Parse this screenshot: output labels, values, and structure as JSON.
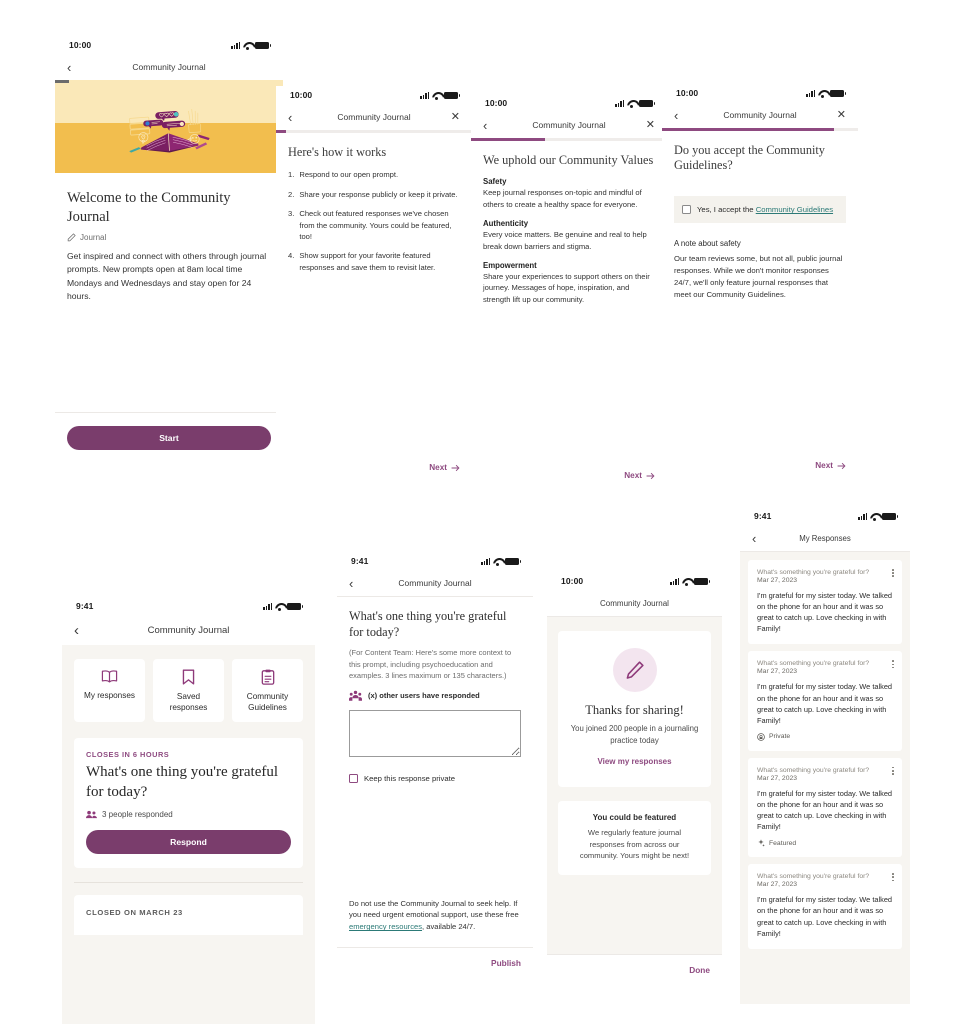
{
  "brand": {
    "purple": "#7A3D6C",
    "purple_light": "#8E4A80",
    "teal_link": "#2C7A77",
    "bg_warm": "#F7F5F1",
    "hero_light": "#FAE8B8",
    "hero_gold": "#F2BE4E"
  },
  "screen1": {
    "status": {
      "time": "10:00"
    },
    "nav": {
      "back": "‹",
      "title": "Community Journal"
    },
    "title": "Welcome to the Community Journal",
    "meta": "Journal",
    "description": "Get inspired and connect with others through journal prompts. New prompts open at 8am local time Mondays and Wednesdays and stay open for 24 hours.",
    "start_label": "Start"
  },
  "screen2": {
    "status": {
      "time": "10:00"
    },
    "nav": {
      "back": "‹",
      "title": "Community Journal",
      "close": "✕"
    },
    "progress_pct": 5,
    "heading": "Here's how it works",
    "steps": [
      {
        "num": "1.",
        "text": "Respond to our open prompt."
      },
      {
        "num": "2.",
        "text": "Share your response publicly or keep it private."
      },
      {
        "num": "3.",
        "text": "Check out featured responses we've chosen from the community. Yours could be featured, too!"
      },
      {
        "num": "4.",
        "text": "Show support for your favorite featured responses and save them to revisit later."
      }
    ],
    "next_label": "Next"
  },
  "screen3": {
    "status": {
      "time": "10:00"
    },
    "nav": {
      "back": "‹",
      "title": "Community Journal",
      "close": "✕"
    },
    "progress_pct": 38,
    "heading": "We uphold our Community Values",
    "values": [
      {
        "title": "Safety",
        "text": "Keep journal responses on-topic and mindful of others to create a healthy space for everyone."
      },
      {
        "title": "Authenticity",
        "text": "Every voice matters. Be genuine and real to help break down barriers and stigma."
      },
      {
        "title": "Empowerment",
        "text": "Share your experiences to support others on their journey. Messages of hope, inspiration, and strength lift up our community."
      }
    ],
    "next_label": "Next"
  },
  "screen4": {
    "status": {
      "time": "10:00"
    },
    "nav": {
      "back": "‹",
      "title": "Community Journal",
      "close": "✕"
    },
    "progress_pct": 88,
    "heading": "Do you accept the Community Guidelines?",
    "accept_prefix": "Yes, I accept the ",
    "accept_link": "Community Guidelines",
    "checkbox_checked": false,
    "note_heading": "A note about safety",
    "note_text": "Our team reviews some, but not all, public journal responses. While we don't monitor responses 24/7, we'll only feature journal responses that meet our Community Guidelines.",
    "next_label": "Next"
  },
  "screen5": {
    "status": {
      "time": "9:41"
    },
    "nav": {
      "back": "‹",
      "title": "Community Journal"
    },
    "tiles": [
      {
        "icon": "book-icon",
        "label": "My responses"
      },
      {
        "icon": "bookmark-icon",
        "label": "Saved responses"
      },
      {
        "icon": "clipboard-icon",
        "label": "Community Guidelines"
      }
    ],
    "prompt": {
      "status_label": "CLOSES IN 6 HOURS",
      "title": "What's one thing you're grateful for today?",
      "responded": "3 people responded",
      "button": "Respond"
    },
    "closed_label": "CLOSED ON MARCH 23"
  },
  "screen6": {
    "status": {
      "time": "9:41"
    },
    "nav": {
      "back": "‹",
      "title": "Community Journal"
    },
    "prompt": "What's one thing you're grateful for today?",
    "context": "(For  Content Team: Here's some more context to this prompt, including psychoeducation and examples. 3 lines maximum or 135 characters.)",
    "responders": "(x) other users have responded",
    "textarea_value": "",
    "private_label": "Keep this response private",
    "private_checked": false,
    "disclaimer_pre": "Do not use the Community Journal to seek help. If you need urgent emotional support, use these free ",
    "disclaimer_link": "emergency resources",
    "disclaimer_post": ", available 24/7.",
    "publish_label": "Publish"
  },
  "screen7": {
    "status": {
      "time": "10:00"
    },
    "nav": {
      "title": "Community Journal"
    },
    "icon": "pencil-icon",
    "title": "Thanks for sharing!",
    "subtitle": "You joined 200 people in a journaling practice today",
    "link": "View my responses",
    "feature_title": "You could be featured",
    "feature_text": "We regularly feature journal responses from across our community. Yours might be next!",
    "done_label": "Done"
  },
  "screen8": {
    "status": {
      "time": "9:41"
    },
    "nav": {
      "back": "‹",
      "title": "My Responses"
    },
    "responses": [
      {
        "question": "What's something you're grateful for?",
        "date": "Mar 27, 2023",
        "body": "I'm grateful for my sister today. We talked on the phone for an hour and it was so great to catch up. Love checking in with Family!",
        "tag": "",
        "tag_icon": ""
      },
      {
        "question": "What's something you're grateful for?",
        "date": "Mar 27, 2023",
        "body": "I'm grateful for my sister today. We talked on the phone for an hour and it was so great to catch up. Love checking in with Family!",
        "tag": "Private",
        "tag_icon": "lock-icon"
      },
      {
        "question": "What's something you're grateful for?",
        "date": "Mar 27, 2023",
        "body": "I'm grateful for my sister today. We talked on the phone for an hour and it was so great to catch up. Love checking in with Family!",
        "tag": "Featured",
        "tag_icon": "sparkle-icon"
      },
      {
        "question": "What's something you're grateful for?",
        "date": "Mar 27, 2023",
        "body": "I'm grateful for my sister today. We talked on the phone for an hour and it was so great to catch up. Love checking in with Family!",
        "tag": "",
        "tag_icon": ""
      }
    ]
  }
}
